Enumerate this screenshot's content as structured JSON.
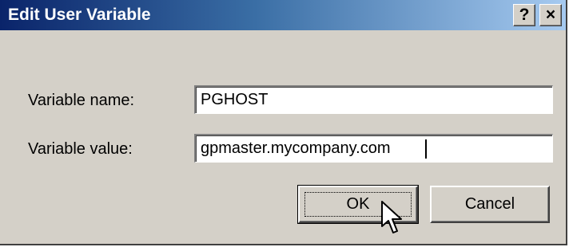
{
  "window": {
    "title": "Edit User Variable",
    "help_label": "?",
    "close_label": "×"
  },
  "form": {
    "name_label": "Variable name:",
    "name_value": "PGHOST",
    "value_label": "Variable value:",
    "value_value": "gpmaster.mycompany.com"
  },
  "buttons": {
    "ok_label": "OK",
    "cancel_label": "Cancel"
  },
  "icons": {
    "help": "question-mark",
    "close": "x-mark",
    "cursor": "mouse-pointer"
  }
}
